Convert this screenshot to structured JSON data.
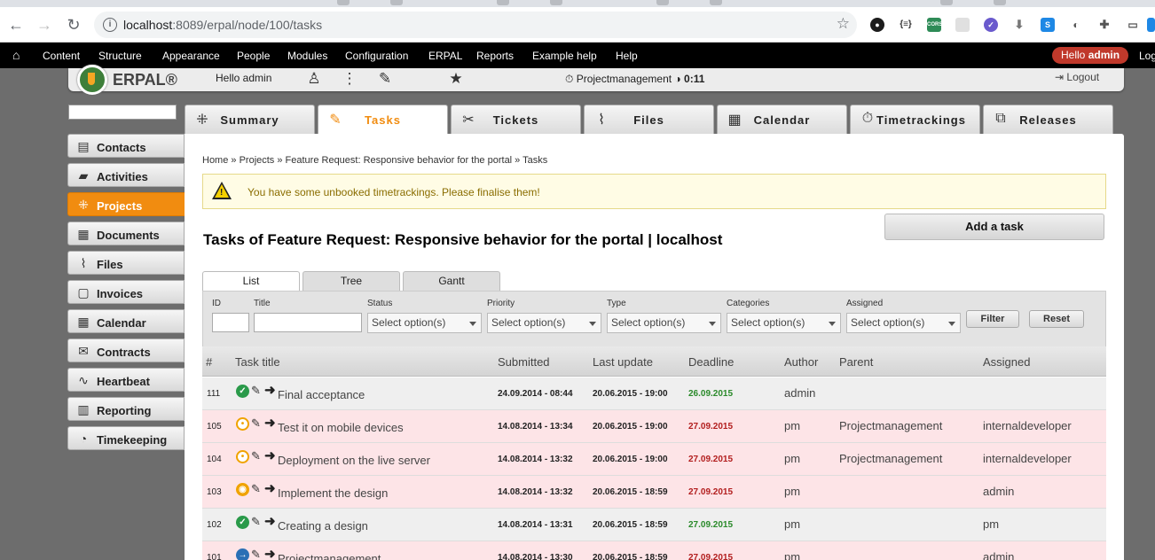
{
  "browser": {
    "url_host": "localhost",
    "url_rest": ":8089/erpal/node/100/tasks"
  },
  "toolbar": {
    "items": [
      "Content",
      "Structure",
      "Appearance",
      "People",
      "Modules",
      "Configuration",
      "ERPAL",
      "Reports",
      "Example help",
      "Help"
    ],
    "hello_prefix": "Hello ",
    "hello_user": "admin",
    "logout_partial": "Log"
  },
  "header": {
    "logo_text": "ERPAL®",
    "greeting": "Hello admin",
    "timer_project": "Projectmanagement",
    "timer_value": "0:11",
    "logout": "Logout"
  },
  "sidebar": {
    "items": [
      {
        "label": "Contacts",
        "icon": "contacts-icon"
      },
      {
        "label": "Activities",
        "icon": "activities-icon"
      },
      {
        "label": "Projects",
        "icon": "projects-icon",
        "active": true
      },
      {
        "label": "Documents",
        "icon": "documents-icon"
      },
      {
        "label": "Files",
        "icon": "files-icon"
      },
      {
        "label": "Invoices",
        "icon": "invoices-icon"
      },
      {
        "label": "Calendar",
        "icon": "calendar-icon"
      },
      {
        "label": "Contracts",
        "icon": "contracts-icon"
      },
      {
        "label": "Heartbeat",
        "icon": "heartbeat-icon"
      },
      {
        "label": "Reporting",
        "icon": "reporting-icon"
      },
      {
        "label": "Timekeeping",
        "icon": "timekeeping-icon"
      }
    ]
  },
  "tabs": [
    {
      "label": "Summary",
      "icon": "summary-icon"
    },
    {
      "label": "Tasks",
      "icon": "wrench-icon",
      "active": true
    },
    {
      "label": "Tickets",
      "icon": "tickets-icon"
    },
    {
      "label": "Files",
      "icon": "paperclip-icon"
    },
    {
      "label": "Calendar",
      "icon": "calendar-icon"
    },
    {
      "label": "Timetrackings",
      "icon": "stopwatch-icon"
    },
    {
      "label": "Releases",
      "icon": "releases-icon"
    }
  ],
  "breadcrumb": "Home » Projects » Feature Request: Responsive behavior for the portal » Tasks",
  "warning": "You have some unbooked timetrackings. Please finalise them!",
  "add_task": "Add a task",
  "page_title": "Tasks of Feature Request: Responsive behavior for the portal | localhost",
  "view_tabs": [
    "List",
    "Tree",
    "Gantt"
  ],
  "filters": {
    "labels": [
      "ID",
      "Title",
      "Status",
      "Priority",
      "Type",
      "Categories",
      "Assigned"
    ],
    "select_placeholder": "Select option(s)",
    "filter_button": "Filter",
    "reset_button": "Reset"
  },
  "table": {
    "columns": [
      "#",
      "Task title",
      "Submitted",
      "Last update",
      "Deadline",
      "Author",
      "Parent",
      "Assigned"
    ],
    "rows": [
      {
        "id": "111",
        "title": "Final acceptance",
        "status": "done",
        "submitted": "24.09.2014 - 08:44",
        "updated": "20.06.2015 - 19:00",
        "deadline": "26.09.2015",
        "deadline_state": "green",
        "author": "admin",
        "parent": "",
        "assigned": "",
        "bg": "grey"
      },
      {
        "id": "105",
        "title": "Test it on mobile devices",
        "status": "inprogress",
        "submitted": "14.08.2014 - 13:34",
        "updated": "20.06.2015 - 19:00",
        "deadline": "27.09.2015",
        "deadline_state": "red",
        "author": "pm",
        "parent": "Projectmanagement",
        "assigned": "internaldeveloper",
        "bg": "pink"
      },
      {
        "id": "104",
        "title": "Deployment on the live server",
        "status": "inprogress",
        "submitted": "14.08.2014 - 13:32",
        "updated": "20.06.2015 - 19:00",
        "deadline": "27.09.2015",
        "deadline_state": "red",
        "author": "pm",
        "parent": "Projectmanagement",
        "assigned": "internaldeveloper",
        "bg": "pink"
      },
      {
        "id": "103",
        "title": "Implement the design",
        "status": "review",
        "submitted": "14.08.2014 - 13:32",
        "updated": "20.06.2015 - 18:59",
        "deadline": "27.09.2015",
        "deadline_state": "red",
        "author": "pm",
        "parent": "",
        "assigned": "admin",
        "bg": "pink"
      },
      {
        "id": "102",
        "title": "Creating a design",
        "status": "done",
        "submitted": "14.08.2014 - 13:31",
        "updated": "20.06.2015 - 18:59",
        "deadline": "27.09.2015",
        "deadline_state": "green",
        "author": "pm",
        "parent": "",
        "assigned": "pm",
        "bg": "grey"
      },
      {
        "id": "101",
        "title": "Projectmanagement",
        "status": "open",
        "submitted": "14.08.2014 - 13:30",
        "updated": "20.06.2015 - 18:59",
        "deadline": "27.09.2015",
        "deadline_state": "red",
        "author": "pm",
        "parent": "",
        "assigned": "admin",
        "bg": "pink"
      }
    ]
  }
}
